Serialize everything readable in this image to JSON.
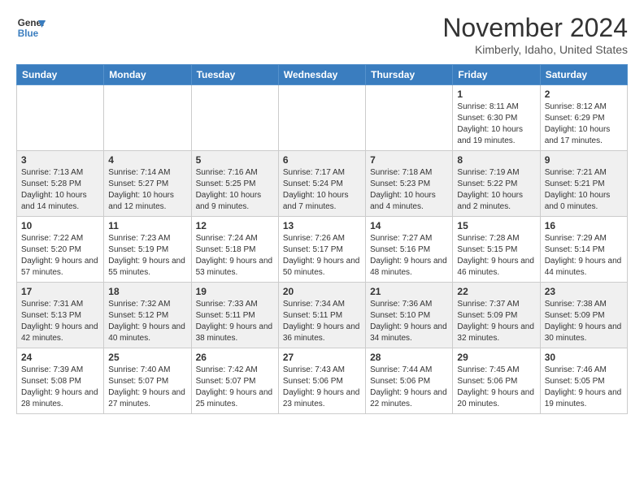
{
  "header": {
    "logo_line1": "General",
    "logo_line2": "Blue",
    "month_title": "November 2024",
    "location": "Kimberly, Idaho, United States"
  },
  "days_of_week": [
    "Sunday",
    "Monday",
    "Tuesday",
    "Wednesday",
    "Thursday",
    "Friday",
    "Saturday"
  ],
  "weeks": [
    [
      {
        "day": "",
        "info": ""
      },
      {
        "day": "",
        "info": ""
      },
      {
        "day": "",
        "info": ""
      },
      {
        "day": "",
        "info": ""
      },
      {
        "day": "",
        "info": ""
      },
      {
        "day": "1",
        "info": "Sunrise: 8:11 AM\nSunset: 6:30 PM\nDaylight: 10 hours and 19 minutes."
      },
      {
        "day": "2",
        "info": "Sunrise: 8:12 AM\nSunset: 6:29 PM\nDaylight: 10 hours and 17 minutes."
      }
    ],
    [
      {
        "day": "3",
        "info": "Sunrise: 7:13 AM\nSunset: 5:28 PM\nDaylight: 10 hours and 14 minutes."
      },
      {
        "day": "4",
        "info": "Sunrise: 7:14 AM\nSunset: 5:27 PM\nDaylight: 10 hours and 12 minutes."
      },
      {
        "day": "5",
        "info": "Sunrise: 7:16 AM\nSunset: 5:25 PM\nDaylight: 10 hours and 9 minutes."
      },
      {
        "day": "6",
        "info": "Sunrise: 7:17 AM\nSunset: 5:24 PM\nDaylight: 10 hours and 7 minutes."
      },
      {
        "day": "7",
        "info": "Sunrise: 7:18 AM\nSunset: 5:23 PM\nDaylight: 10 hours and 4 minutes."
      },
      {
        "day": "8",
        "info": "Sunrise: 7:19 AM\nSunset: 5:22 PM\nDaylight: 10 hours and 2 minutes."
      },
      {
        "day": "9",
        "info": "Sunrise: 7:21 AM\nSunset: 5:21 PM\nDaylight: 10 hours and 0 minutes."
      }
    ],
    [
      {
        "day": "10",
        "info": "Sunrise: 7:22 AM\nSunset: 5:20 PM\nDaylight: 9 hours and 57 minutes."
      },
      {
        "day": "11",
        "info": "Sunrise: 7:23 AM\nSunset: 5:19 PM\nDaylight: 9 hours and 55 minutes."
      },
      {
        "day": "12",
        "info": "Sunrise: 7:24 AM\nSunset: 5:18 PM\nDaylight: 9 hours and 53 minutes."
      },
      {
        "day": "13",
        "info": "Sunrise: 7:26 AM\nSunset: 5:17 PM\nDaylight: 9 hours and 50 minutes."
      },
      {
        "day": "14",
        "info": "Sunrise: 7:27 AM\nSunset: 5:16 PM\nDaylight: 9 hours and 48 minutes."
      },
      {
        "day": "15",
        "info": "Sunrise: 7:28 AM\nSunset: 5:15 PM\nDaylight: 9 hours and 46 minutes."
      },
      {
        "day": "16",
        "info": "Sunrise: 7:29 AM\nSunset: 5:14 PM\nDaylight: 9 hours and 44 minutes."
      }
    ],
    [
      {
        "day": "17",
        "info": "Sunrise: 7:31 AM\nSunset: 5:13 PM\nDaylight: 9 hours and 42 minutes."
      },
      {
        "day": "18",
        "info": "Sunrise: 7:32 AM\nSunset: 5:12 PM\nDaylight: 9 hours and 40 minutes."
      },
      {
        "day": "19",
        "info": "Sunrise: 7:33 AM\nSunset: 5:11 PM\nDaylight: 9 hours and 38 minutes."
      },
      {
        "day": "20",
        "info": "Sunrise: 7:34 AM\nSunset: 5:11 PM\nDaylight: 9 hours and 36 minutes."
      },
      {
        "day": "21",
        "info": "Sunrise: 7:36 AM\nSunset: 5:10 PM\nDaylight: 9 hours and 34 minutes."
      },
      {
        "day": "22",
        "info": "Sunrise: 7:37 AM\nSunset: 5:09 PM\nDaylight: 9 hours and 32 minutes."
      },
      {
        "day": "23",
        "info": "Sunrise: 7:38 AM\nSunset: 5:09 PM\nDaylight: 9 hours and 30 minutes."
      }
    ],
    [
      {
        "day": "24",
        "info": "Sunrise: 7:39 AM\nSunset: 5:08 PM\nDaylight: 9 hours and 28 minutes."
      },
      {
        "day": "25",
        "info": "Sunrise: 7:40 AM\nSunset: 5:07 PM\nDaylight: 9 hours and 27 minutes."
      },
      {
        "day": "26",
        "info": "Sunrise: 7:42 AM\nSunset: 5:07 PM\nDaylight: 9 hours and 25 minutes."
      },
      {
        "day": "27",
        "info": "Sunrise: 7:43 AM\nSunset: 5:06 PM\nDaylight: 9 hours and 23 minutes."
      },
      {
        "day": "28",
        "info": "Sunrise: 7:44 AM\nSunset: 5:06 PM\nDaylight: 9 hours and 22 minutes."
      },
      {
        "day": "29",
        "info": "Sunrise: 7:45 AM\nSunset: 5:06 PM\nDaylight: 9 hours and 20 minutes."
      },
      {
        "day": "30",
        "info": "Sunrise: 7:46 AM\nSunset: 5:05 PM\nDaylight: 9 hours and 19 minutes."
      }
    ]
  ]
}
